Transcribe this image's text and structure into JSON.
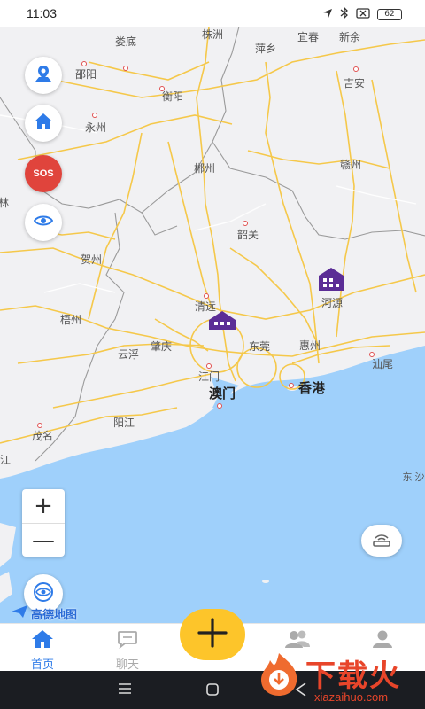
{
  "status_bar": {
    "time": "11:03",
    "battery": "62"
  },
  "map": {
    "land_color": "#f1f1f3",
    "water_color": "#9fd0fb",
    "highway_color": "#f5c84a",
    "cities": [
      {
        "name": "娄底",
        "major": false
      },
      {
        "name": "株洲",
        "major": false
      },
      {
        "name": "萍乡",
        "major": false
      },
      {
        "name": "宜春",
        "major": false
      },
      {
        "name": "新余",
        "major": false
      },
      {
        "name": "邵阳",
        "major": false
      },
      {
        "name": "衡阳",
        "major": false
      },
      {
        "name": "吉安",
        "major": false
      },
      {
        "name": "永州",
        "major": false
      },
      {
        "name": "郴州",
        "major": false
      },
      {
        "name": "赣州",
        "major": false
      },
      {
        "name": "韶关",
        "major": false
      },
      {
        "name": "贺州",
        "major": false
      },
      {
        "name": "河源",
        "major": false
      },
      {
        "name": "清远",
        "major": false
      },
      {
        "name": "梧州",
        "major": false
      },
      {
        "name": "肇庆",
        "major": false
      },
      {
        "name": "东莞",
        "major": false
      },
      {
        "name": "惠州",
        "major": false
      },
      {
        "name": "云浮",
        "major": false
      },
      {
        "name": "江门",
        "major": false
      },
      {
        "name": "汕尾",
        "major": false
      },
      {
        "name": "澳门",
        "major": true
      },
      {
        "name": "香港",
        "major": true
      },
      {
        "name": "阳江",
        "major": false
      },
      {
        "name": "茂名",
        "major": false
      },
      {
        "name": "东 沙",
        "major": false
      },
      {
        "name": "林",
        "major": false
      },
      {
        "name": "江",
        "major": false
      }
    ],
    "side_buttons": [
      {
        "name": "map-pin-icon"
      },
      {
        "name": "home-icon"
      },
      {
        "name": "sos-icon",
        "label": "SOS"
      },
      {
        "name": "eye-icon"
      }
    ],
    "zoom_in": "+",
    "zoom_out": "—",
    "logo_text": "高德地图"
  },
  "bottom_nav": {
    "items": [
      {
        "label": "首页",
        "icon": "home-icon",
        "active": true
      },
      {
        "label": "聊天",
        "icon": "chat-icon",
        "active": false
      },
      {
        "label": "",
        "icon": "contacts-icon",
        "active": false
      },
      {
        "label": "",
        "icon": "user-icon",
        "active": false
      }
    ],
    "plus_label": "+"
  },
  "watermark": {
    "text": "下载火",
    "domain": "xiazaihuo.com"
  }
}
